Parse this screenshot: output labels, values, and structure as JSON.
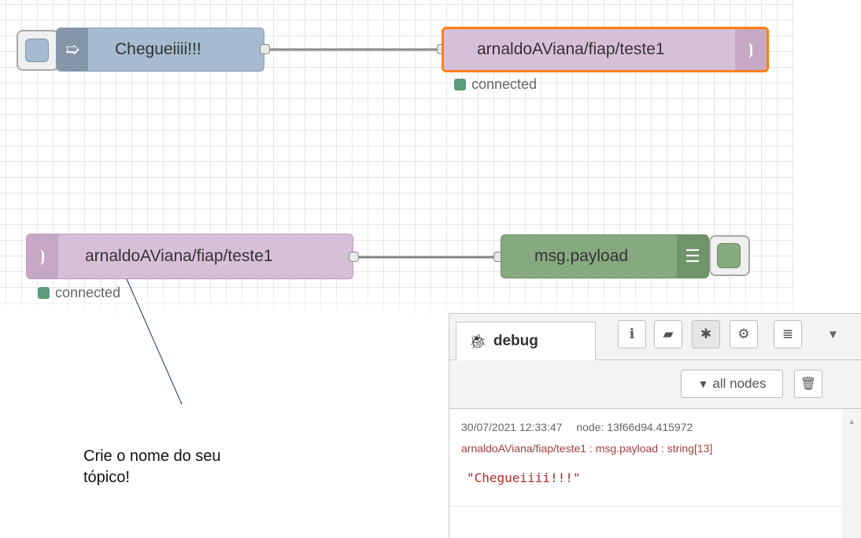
{
  "flow1": {
    "inject_label": "Chegueiiii!!!",
    "mqtt_out_label": "arnaldoAViana/fiap/teste1",
    "mqtt_out_status": "connected"
  },
  "flow2": {
    "mqtt_in_label": "arnaldoAViana/fiap/teste1",
    "mqtt_in_status": "connected",
    "debug_label": "msg.payload"
  },
  "annotation": {
    "line1": "Crie o nome do seu",
    "line2": "tópico!"
  },
  "debug_panel": {
    "tab_label": "debug",
    "tab_icons": [
      "info-icon",
      "book-icon",
      "bug-icon",
      "gear-icon",
      "database-icon"
    ],
    "filter_label": "all nodes",
    "messages": [
      {
        "timestamp": "30/07/2021 12:33:47",
        "node": "node: 13f66d94.415972",
        "topic_line": "arnaldoAViana/fiap/teste1 : msg.payload : string[13]",
        "value": "\"Chegueiiii!!!\""
      }
    ]
  },
  "colors": {
    "inject": "#a6bbcf",
    "mqtt": "#d8bfd8",
    "debug": "#87a980",
    "selected_border": "#ff7f0e",
    "status_green": "#5a9b7b"
  }
}
